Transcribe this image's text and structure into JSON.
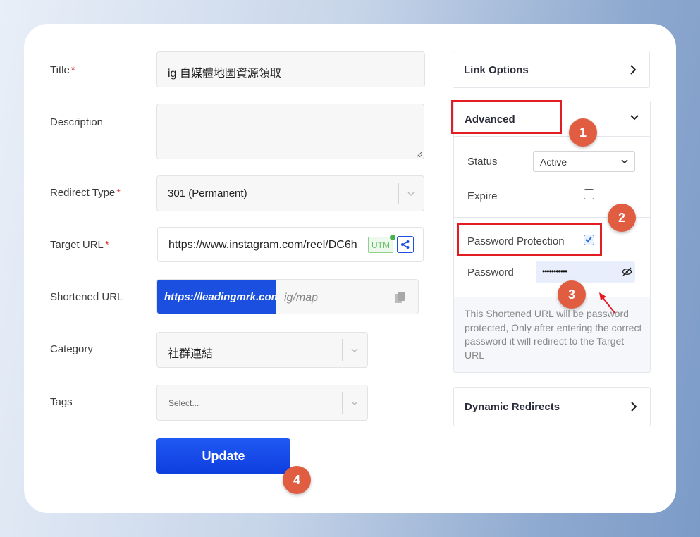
{
  "form": {
    "title_label": "Title",
    "title_value": "ig 自媒體地圖資源領取",
    "description_label": "Description",
    "description_value": "",
    "redirect_label": "Redirect Type",
    "redirect_value": "301 (Permanent)",
    "target_label": "Target URL",
    "target_value": "https://www.instagram.com/reel/DC6h",
    "utm_label": "UTM",
    "short_label": "Shortened URL",
    "short_domain": "https://leadingmrk.com",
    "short_path": "ig/map",
    "category_label": "Category",
    "category_value": "社群連結",
    "tags_label": "Tags",
    "tags_placeholder": "Select...",
    "update_label": "Update",
    "required_mark": "*"
  },
  "sidebar": {
    "link_options": "Link Options",
    "advanced": "Advanced",
    "status_label": "Status",
    "status_value": "Active",
    "expire_label": "Expire",
    "expire_checked": false,
    "password_protection_label": "Password Protection",
    "password_protection_checked": true,
    "password_label": "Password",
    "password_value": "•••••••••••",
    "help_text": "This Shortened URL will be password protected, Only after entering the correct password it will redirect to the Target URL",
    "dynamic_redirects": "Dynamic Redirects"
  },
  "callouts": [
    "1",
    "2",
    "3",
    "4"
  ],
  "colors": {
    "accent_blue": "#1a4fe0",
    "callout": "#e15d42",
    "highlight_red": "#e31b23",
    "utm_green": "#4caf50"
  }
}
